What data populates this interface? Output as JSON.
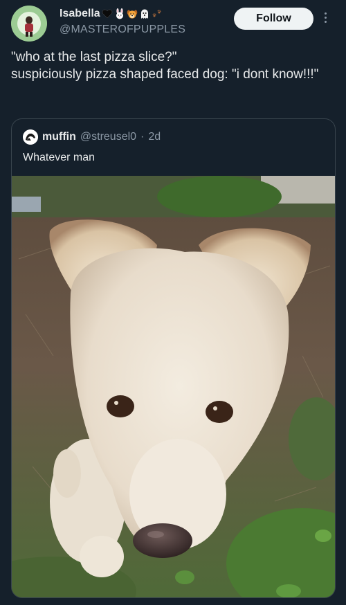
{
  "post": {
    "author": {
      "display_name": "Isabella",
      "handle": "@MASTEROFPUPPLES",
      "badge_emojis": [
        "black-heart-emoji",
        "rabbit-emoji",
        "dog-face-emoji",
        "ghost-emoji",
        "paw-prints-emoji"
      ]
    },
    "follow_label": "Follow",
    "text": "\"who at the last pizza slice?\"\nsuspiciously pizza shaped faced dog: \"i dont know!!!\""
  },
  "quoted_post": {
    "display_name": "muffin",
    "handle": "@streusel0",
    "separator": "·",
    "time": "2d",
    "text": "Whatever man",
    "media": "photo-white-puppy-on-grass"
  },
  "colors": {
    "background": "#15202b",
    "text_primary": "#e7e9ea",
    "text_secondary": "#8b98a5",
    "border": "#38444d",
    "button_bg": "#eff3f4",
    "button_text": "#0f1419"
  }
}
